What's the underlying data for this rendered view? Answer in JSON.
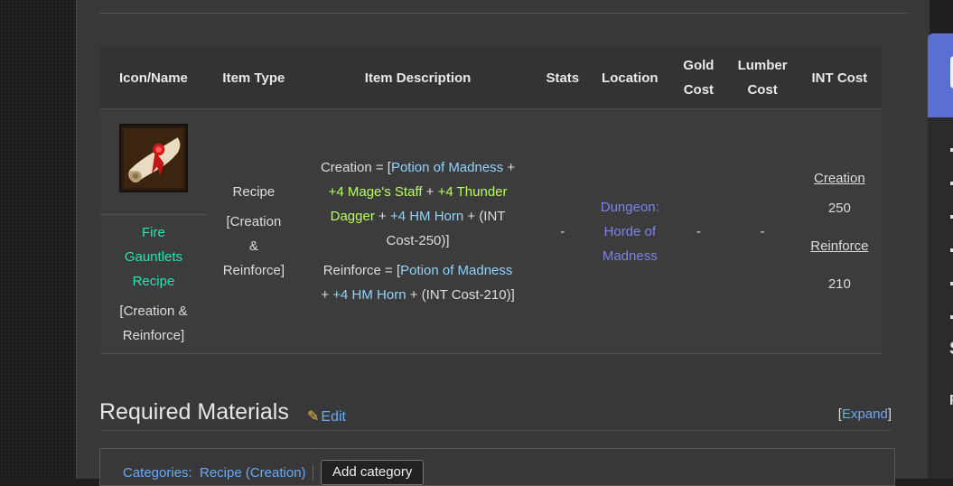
{
  "table": {
    "headers": {
      "icon_name": "Icon/Name",
      "item_type": "Item Type",
      "item_description": "Item Description",
      "stats": "Stats",
      "location": "Location",
      "gold_cost_1": "Gold",
      "gold_cost_2": "Cost",
      "lumber_cost_1": "Lumber",
      "lumber_cost_2": "Cost",
      "int_cost": "INT Cost"
    },
    "row": {
      "name_line1": "Fire",
      "name_line2": "Gauntlets",
      "name_line3": "Recipe",
      "name_sub1": "[Creation &",
      "name_sub2": "Reinforce]",
      "type_line1": "Recipe",
      "type_line2": "[Creation",
      "type_line3": "&",
      "type_line4": "Reinforce]",
      "desc": {
        "creation_prefix": "Creation = [",
        "potion": "Potion of Madness",
        "plus1": " + ",
        "mage_staff": "+4 Mage's Staff",
        "plus2": " + ",
        "thunder_dagger_1": "+4 Thunder",
        "thunder_dagger_2": "Dagger",
        "plus3": " + ",
        "hm_horn": "+4 HM Horn",
        "creation_suffix_1": " + (INT",
        "creation_suffix_2": "Cost-250)]",
        "reinforce_prefix": "Reinforce = [",
        "potion2": "Potion of Madness",
        "plus4": "+ ",
        "hm_horn2": "+4 HM Horn",
        "reinforce_suffix": " + (INT Cost-210)]"
      },
      "stats": "-",
      "location_line1": "Dungeon:",
      "location_line2": "Horde of",
      "location_line3": "Madness",
      "gold_cost": "-",
      "lumber_cost": "-",
      "int_creation_label": "Creation",
      "int_creation_value": "250",
      "int_reinforce_label": "Reinforce",
      "int_reinforce_value": "210"
    }
  },
  "section": {
    "title": "Required Materials",
    "edit": "Edit",
    "expand_open": "[",
    "expand": "Expand",
    "expand_close": "]"
  },
  "categories": {
    "label": "Categories:",
    "item": "Recipe (Creation)",
    "add_button": "Add category"
  },
  "right_panel": {
    "letter": "S",
    "letter2": "F"
  },
  "colors": {
    "item_name": "#1de9b6",
    "light_blue": "#8fd3ff",
    "lime": "#b4ff5a",
    "location": "#7b83eb",
    "link": "#6aa9f5",
    "panel_header": "#5b6fd2"
  }
}
